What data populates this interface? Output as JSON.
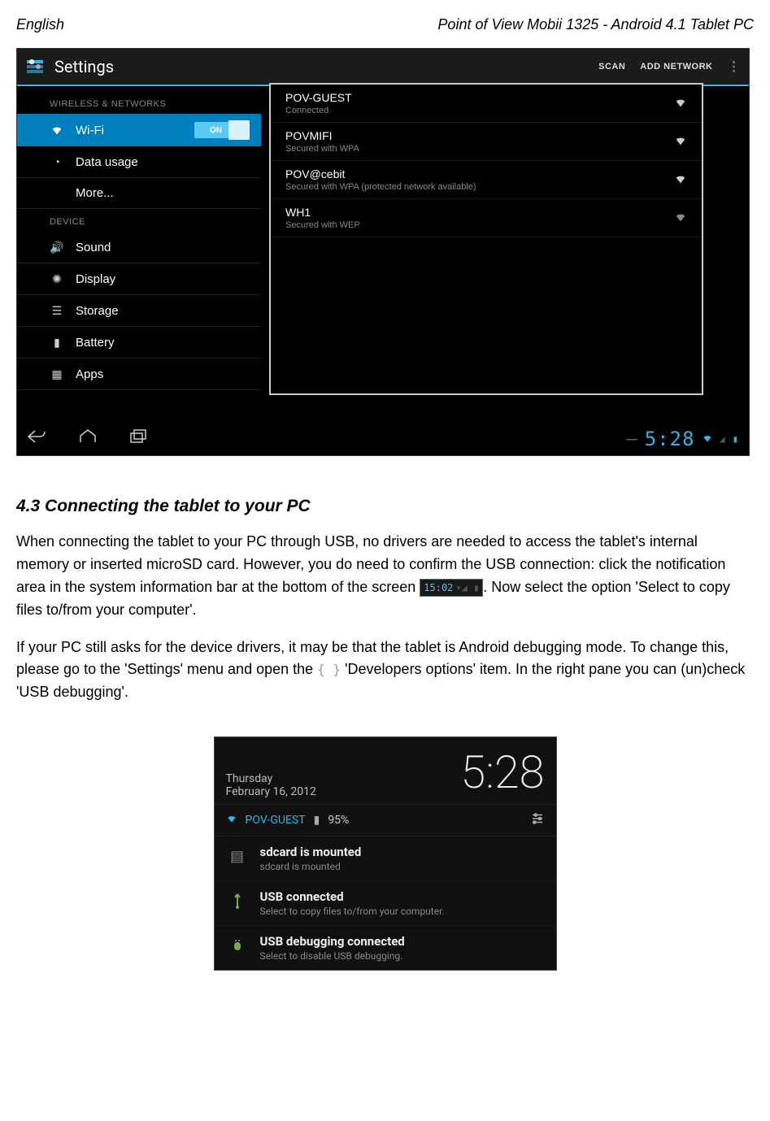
{
  "header": {
    "left": "English",
    "right": "Point of View Mobii 1325 - Android 4.1 Tablet PC"
  },
  "tablet_header": {
    "title": "Settings",
    "scan": "SCAN",
    "add_network": "ADD NETWORK"
  },
  "sidebar": {
    "section_wireless": "WIRELESS & NETWORKS",
    "section_device": "DEVICE",
    "items": [
      {
        "label": "Wi-Fi",
        "switch": "ON"
      },
      {
        "label": "Data usage"
      },
      {
        "label": "More..."
      },
      {
        "label": "Sound"
      },
      {
        "label": "Display"
      },
      {
        "label": "Storage"
      },
      {
        "label": "Battery"
      },
      {
        "label": "Apps"
      }
    ]
  },
  "wifi": {
    "networks": [
      {
        "name": "POV-GUEST",
        "sub": "Connected"
      },
      {
        "name": "POVMIFI",
        "sub": "Secured with WPA"
      },
      {
        "name": "POV@cebit",
        "sub": "Secured with WPA (protected network available)"
      },
      {
        "name": "WH1",
        "sub": "Secured with WEP"
      }
    ]
  },
  "navbar": {
    "clock": "5:28"
  },
  "body": {
    "title": "4.3 Connecting the tablet to your PC",
    "p1a": "When connecting the tablet to your PC through USB, no drivers are needed to access the tablet's internal memory or inserted microSD card. However, you do need to confirm the USB connection:  click the notification area in the system information bar at the bottom of the screen ",
    "inline_clock": "15:02",
    "p1b": ". Now select the option 'Select to copy files to/from your computer'.",
    "p2a": "If your PC still asks for the device drivers, it may be that the tablet is Android debugging mode. To change this, please go to the 'Settings' menu and open the ",
    "curly": "{ }",
    "p2b": " 'Developers options' item. In the right pane you can (un)check 'USB debugging'."
  },
  "notif": {
    "day": "Thursday",
    "date": "February 16, 2012",
    "time": "5:28",
    "wifi_name": "POV-GUEST",
    "battery": "95%",
    "items": [
      {
        "title": "sdcard is mounted",
        "sub": "sdcard is mounted"
      },
      {
        "title": "USB connected",
        "sub": "Select to copy files to/from your computer."
      },
      {
        "title": "USB debugging connected",
        "sub": "Select to disable USB debugging."
      }
    ]
  }
}
